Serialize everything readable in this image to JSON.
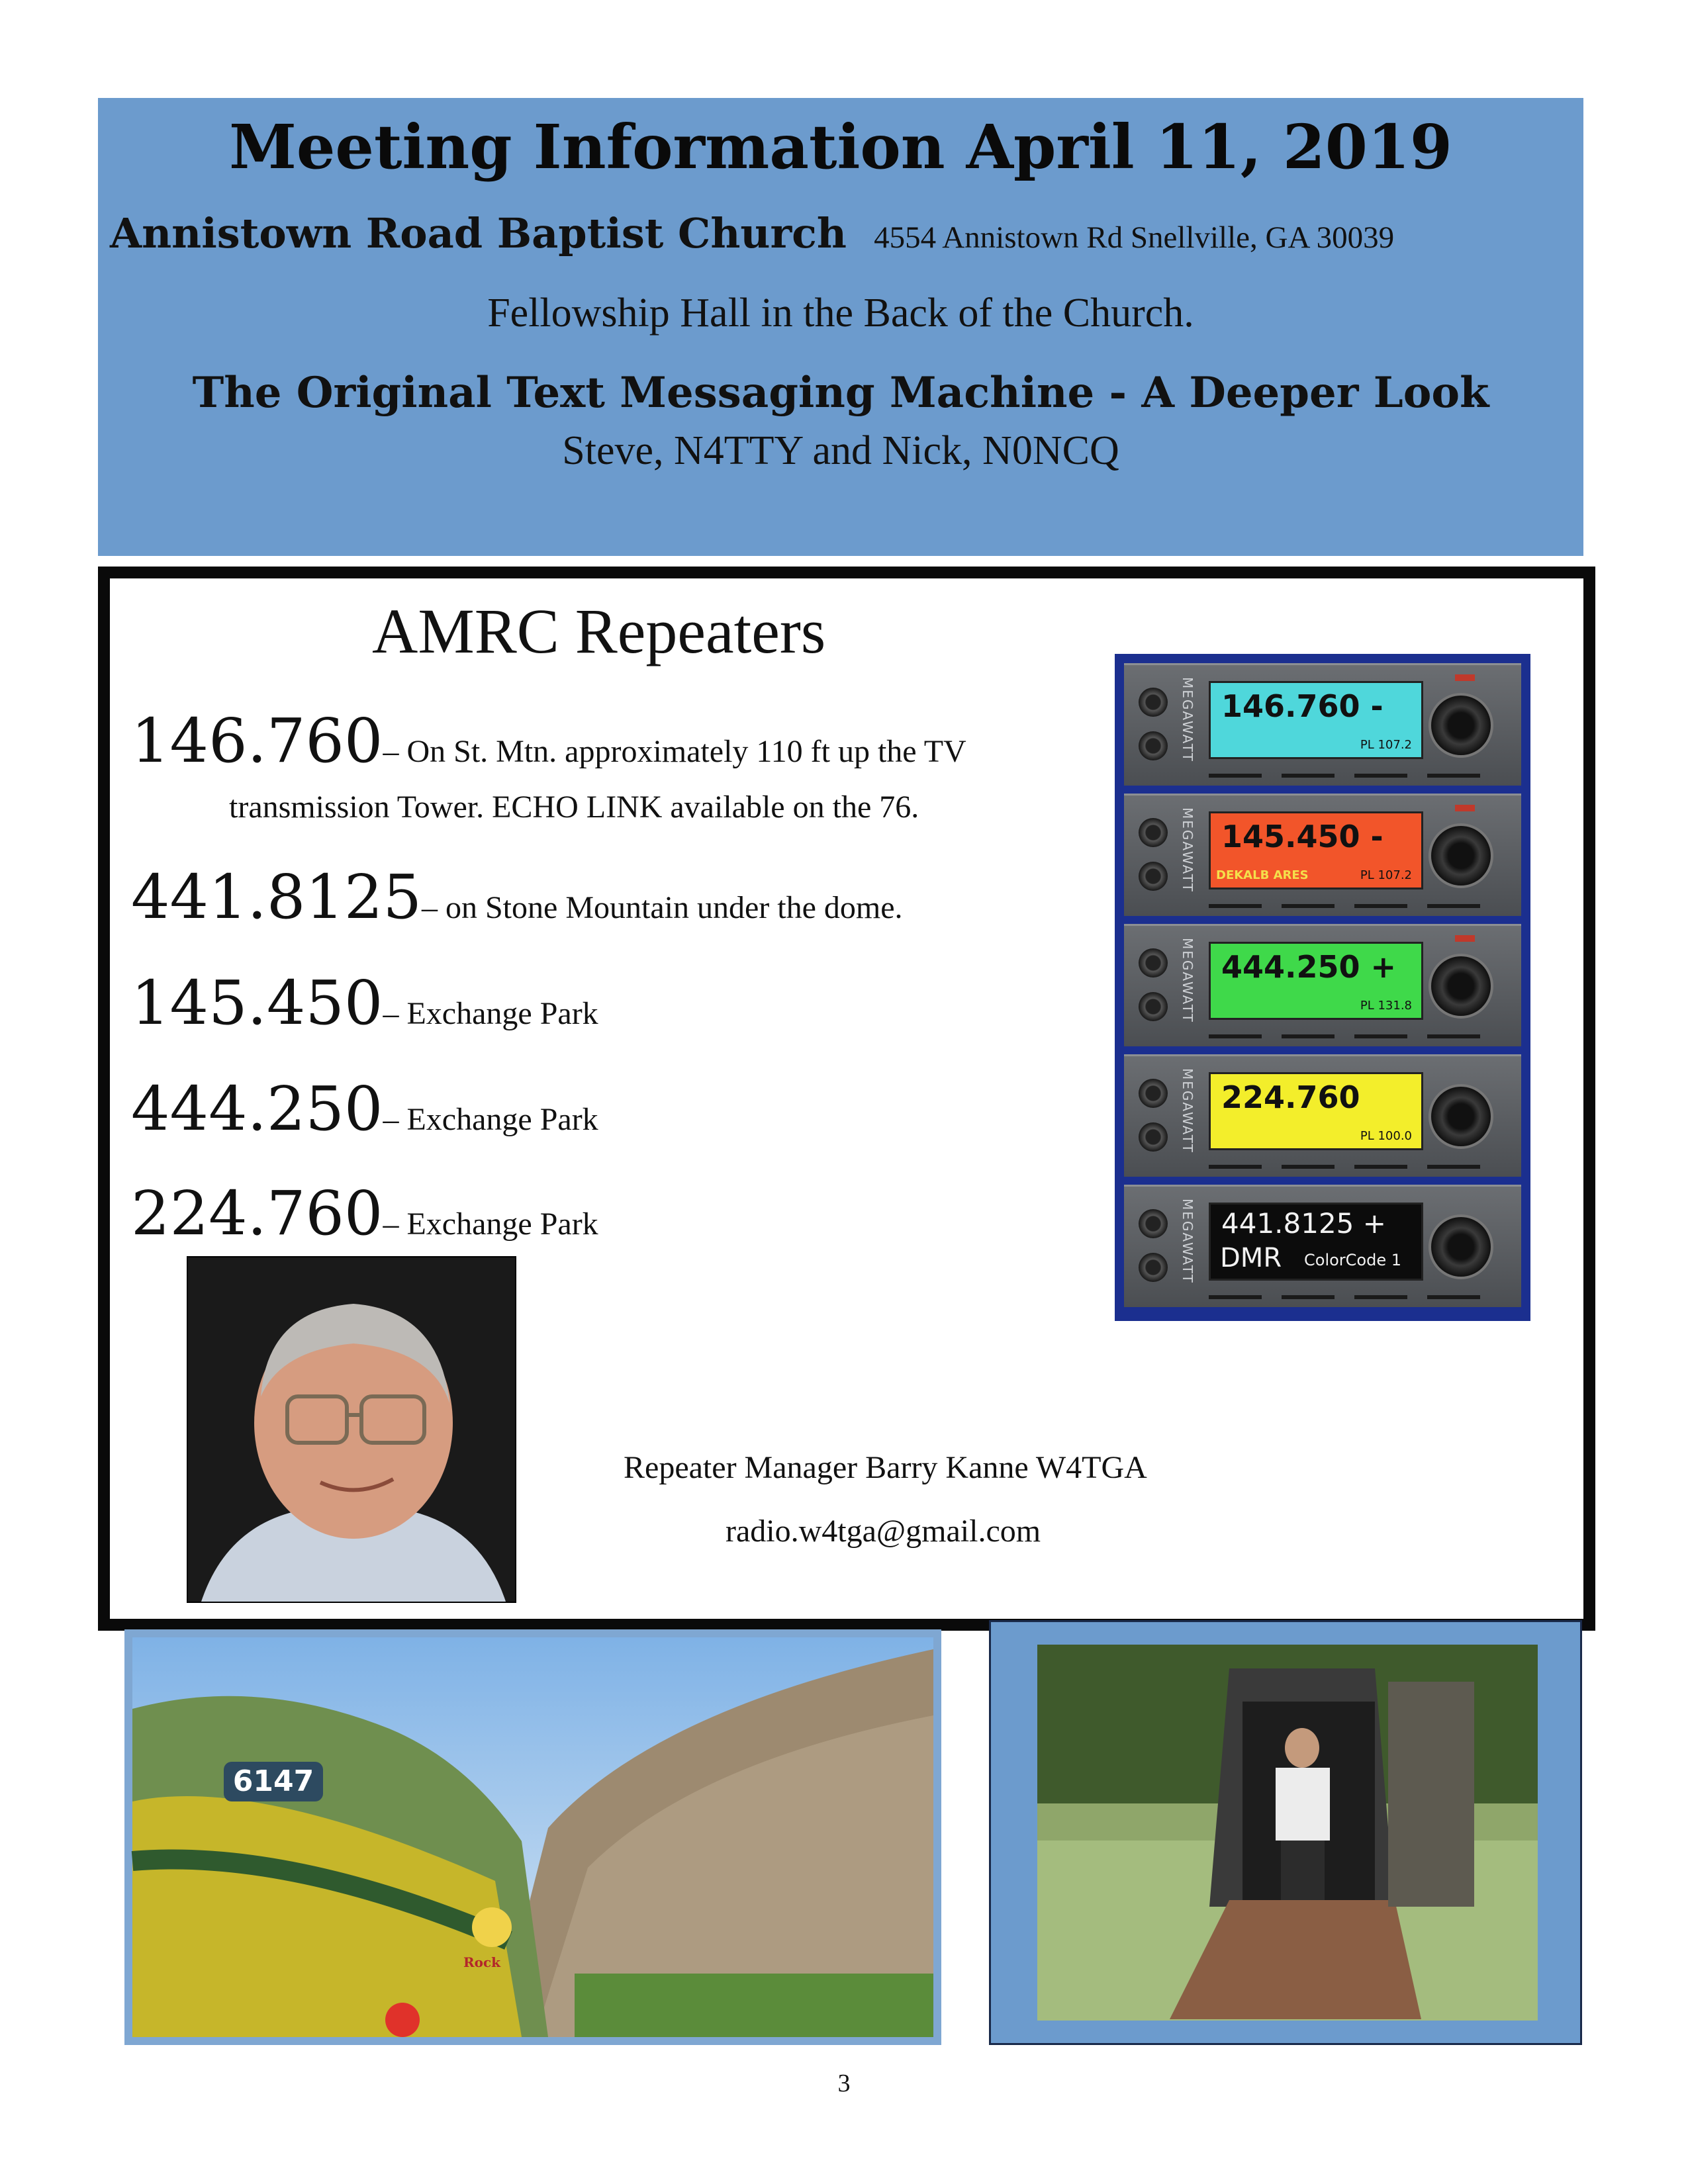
{
  "meeting": {
    "title": "Meeting Information April 11, 2019",
    "church": "Annistown Road Baptist Church",
    "address": "4554 Annistown Rd Snellville, GA 30039",
    "hall": "Fellowship Hall in the Back of the Church.",
    "topic": "The Original Text Messaging Machine - A Deeper Look",
    "speakers": "Steve, N4TTY and Nick, N0NCQ"
  },
  "repeaters": {
    "heading": "AMRC Repeaters",
    "items": [
      {
        "freq": "146.760",
        "desc": "–  On St. Mtn. approximately 110 ft up the  TV",
        "desc2": "transmission Tower.  ECHO LINK available on the 76."
      },
      {
        "freq": "441.8125",
        "desc": "– on Stone Mountain  under the dome."
      },
      {
        "freq": "145.450",
        "desc": "– Exchange Park"
      },
      {
        "freq": "444.250",
        "desc": "– Exchange Park"
      },
      {
        "freq": "224.760",
        "desc": "– Exchange Park"
      }
    ],
    "manager": "Repeater Manager Barry Kanne  W4TGA",
    "email": "radio.w4tga@gmail.com"
  },
  "radio_panel": {
    "brand": "MEGAWATT",
    "radios": [
      {
        "freq": "146.760 -",
        "sub": "PL 107.2",
        "color": "#4fd7db"
      },
      {
        "freq": "145.450 -",
        "left": "DEKALB ARES",
        "sub": "PL 107.2",
        "color": "#f2552a"
      },
      {
        "freq": "444.250 +",
        "sub": "PL 131.8",
        "color": "#3fd94a"
      },
      {
        "freq": "224.760",
        "sub": "PL 100.0",
        "color": "#f3ee2b"
      },
      {
        "freq": "441.8125  +",
        "freq2": "DMR",
        "sub": "ColorCode 1",
        "color": "#0c0c0c"
      }
    ]
  },
  "photos": {
    "train_number": "6147",
    "train_logo": "Rock"
  },
  "page_number": "3"
}
